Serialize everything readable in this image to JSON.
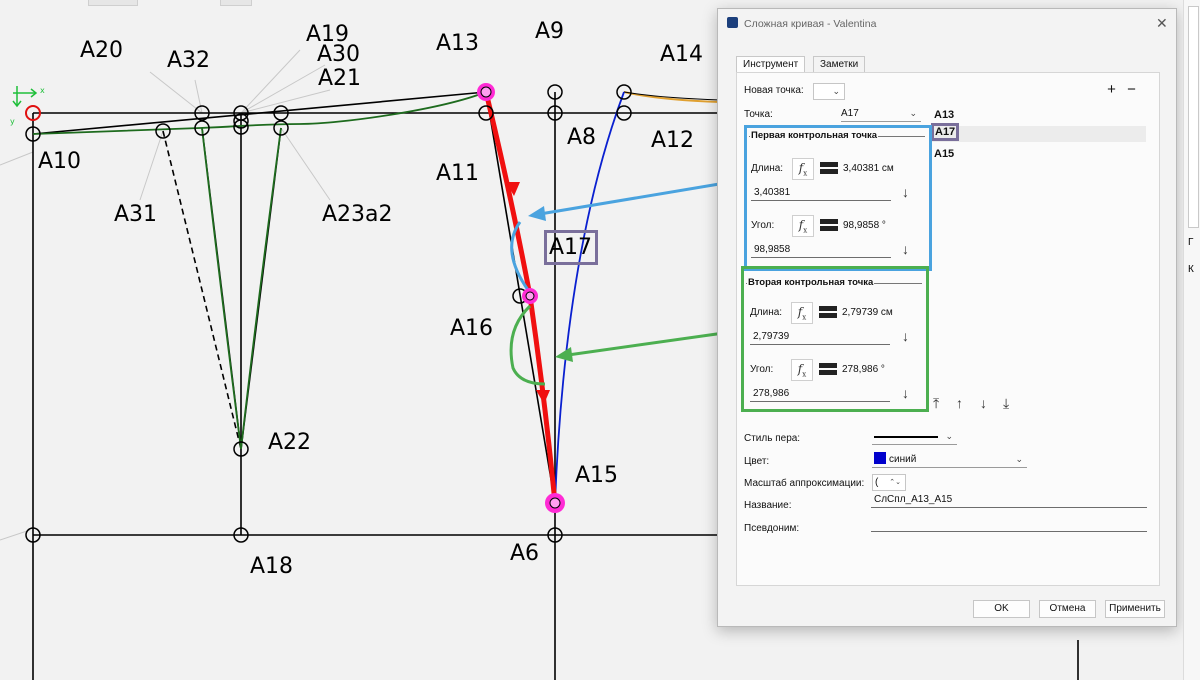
{
  "canvas": {
    "point_labels": [
      {
        "name": "A20",
        "text": "A20"
      },
      {
        "name": "A32",
        "text": "A32"
      },
      {
        "name": "A19",
        "text": "A19"
      },
      {
        "name": "A30",
        "text": "A30"
      },
      {
        "name": "A21",
        "text": "A21"
      },
      {
        "name": "A13",
        "text": "A13"
      },
      {
        "name": "A9",
        "text": "A9"
      },
      {
        "name": "A14",
        "text": "A14"
      },
      {
        "name": "A10",
        "text": "A10"
      },
      {
        "name": "A8",
        "text": "A8"
      },
      {
        "name": "A12",
        "text": "A12"
      },
      {
        "name": "A11",
        "text": "A11"
      },
      {
        "name": "A31",
        "text": "A31"
      },
      {
        "name": "A23a2",
        "text": "A23a2"
      },
      {
        "name": "A17",
        "text": "A17"
      },
      {
        "name": "A16",
        "text": "A16"
      },
      {
        "name": "A22",
        "text": "A22"
      },
      {
        "name": "A15",
        "text": "A15"
      },
      {
        "name": "A6",
        "text": "A6"
      },
      {
        "name": "A18",
        "text": "A18"
      }
    ],
    "axis_x": "x",
    "axis_y": "y"
  },
  "dialog": {
    "title": "Сложная кривая - Valentina",
    "close": "✕",
    "tabs": [
      "Инструмент",
      "Заметки"
    ],
    "new_point_label": "Новая точка:",
    "point_label": "Точка:",
    "point_value": "A17",
    "points_list": [
      "A13",
      "A17",
      "A15"
    ],
    "selected_point": "A17",
    "plus": "+",
    "minus": "−",
    "first_cp": {
      "title": "Первая контрольная точка",
      "length_label": "Длина:",
      "length_result": "3,40381 см",
      "length_value": "3,40381",
      "angle_label": "Угол:",
      "angle_result": "98,9858 °",
      "angle_value": "98,9858"
    },
    "second_cp": {
      "title": "Вторая контрольная точка",
      "length_label": "Длина:",
      "length_result": "2,79739 см",
      "length_value": "2,79739",
      "angle_label": "Угол:",
      "angle_result": "278,986 °",
      "angle_value": "278,986"
    },
    "fx": "f",
    "fx_sub": "x",
    "arrow_down": "↓",
    "move_buttons": [
      "⤒",
      "↑",
      "↓",
      "⤓"
    ],
    "pen_style_label": "Стиль пера:",
    "color_label": "Цвет:",
    "color_value": "синий",
    "color_swatch": "#0000cc",
    "approx_label": "Масштаб аппроксимации:",
    "approx_value": "(",
    "name_label": "Название:",
    "name_value": "СлСпл_А13_А15",
    "alias_label": "Псевдоним:",
    "alias_value": "",
    "ok": "OK",
    "cancel": "Отмена",
    "apply": "Применить"
  },
  "annotations": {
    "label_A17": "A17",
    "blue_box_color": "#4aa3df",
    "green_box_color": "#4caf50",
    "purple_box_color": "#7a6f9b"
  },
  "right_strip": [
    "Г",
    "К"
  ]
}
